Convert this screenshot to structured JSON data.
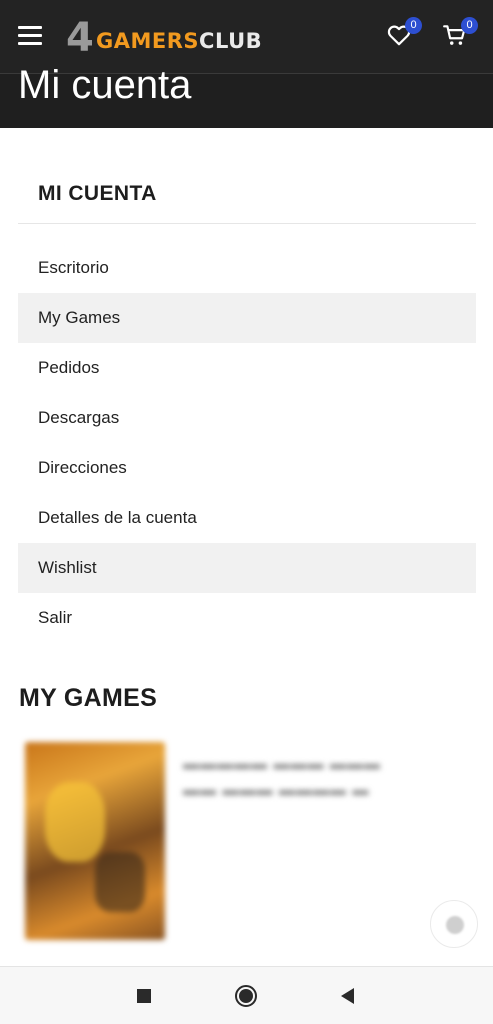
{
  "header": {
    "logo": {
      "prefix": "4",
      "part1": "GAMERS",
      "part2": "CLUB"
    },
    "wishlist_count": "0",
    "cart_count": "0",
    "page_title": "Mi cuenta"
  },
  "account_nav": {
    "title": "MI CUENTA",
    "items": [
      {
        "label": "Escritorio"
      },
      {
        "label": "My Games"
      },
      {
        "label": "Pedidos"
      },
      {
        "label": "Descargas"
      },
      {
        "label": "Direcciones"
      },
      {
        "label": "Detalles de la cuenta"
      },
      {
        "label": "Wishlist"
      },
      {
        "label": "Salir"
      }
    ]
  },
  "my_games": {
    "heading": "MY GAMES"
  },
  "colors": {
    "header_bg": "#232323",
    "logo_accent": "#f29a1f",
    "badge": "#2d4fd1",
    "active_item_bg": "#f1f1f1"
  },
  "icons": [
    "menu-icon",
    "heart-icon",
    "cart-icon",
    "square-icon",
    "circle-icon",
    "back-triangle-icon"
  ]
}
